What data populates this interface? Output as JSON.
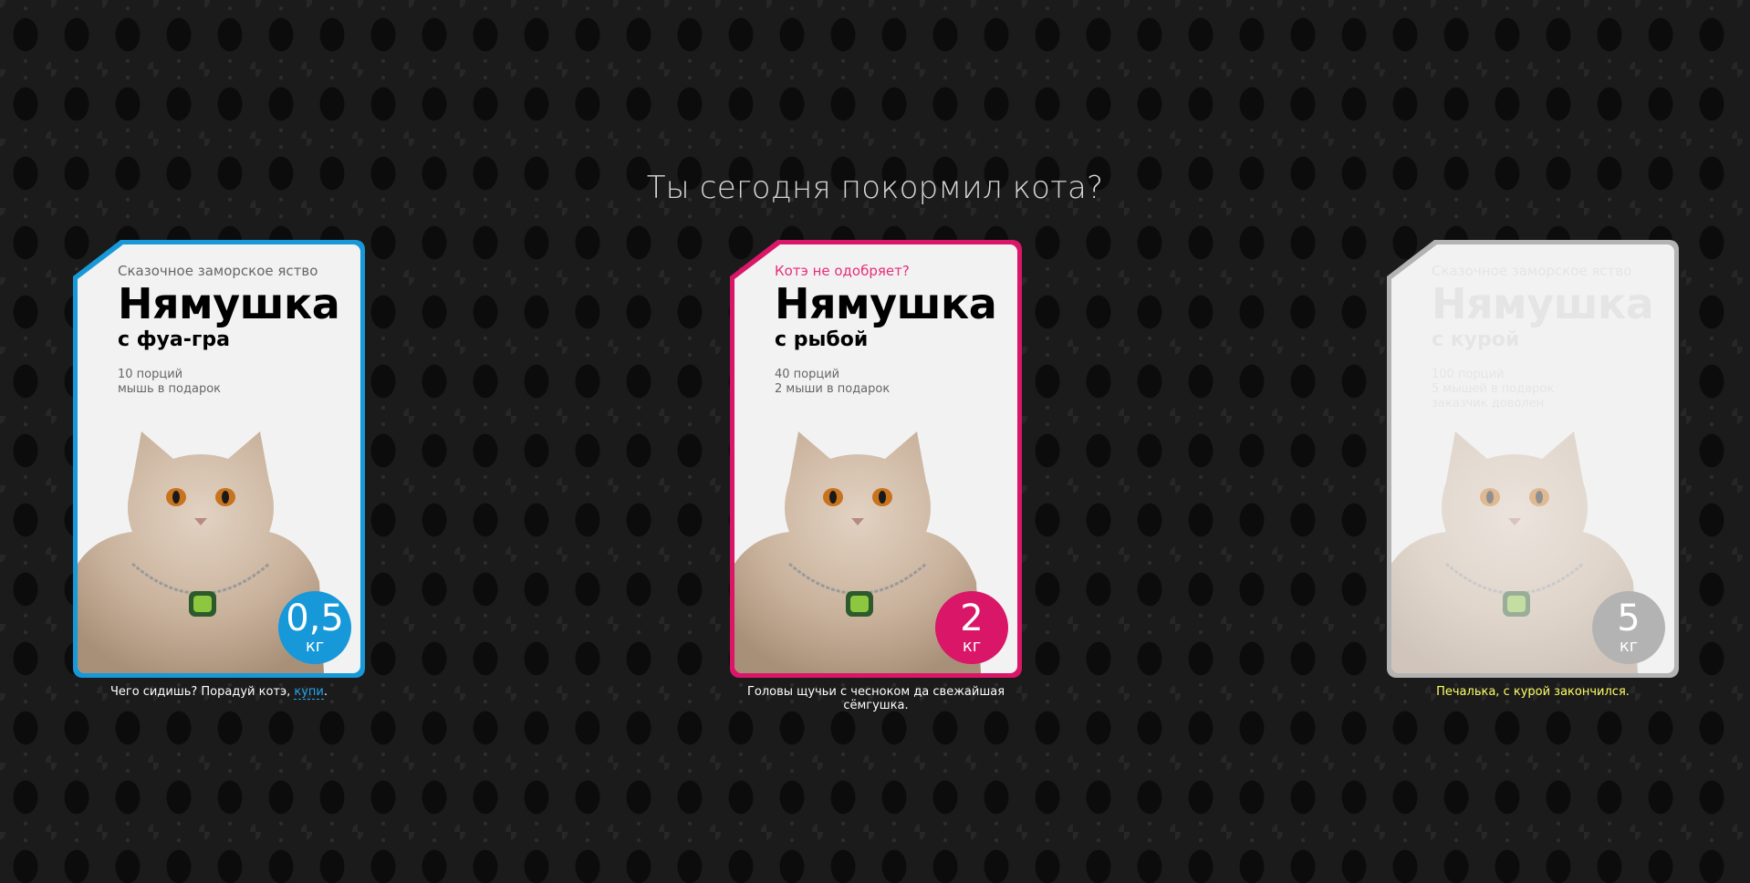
{
  "page_title": "Ты сегодня покормил кота?",
  "products": [
    {
      "tagline": "Сказочное заморское яство",
      "brand": "Нямушка",
      "flavor": "с фуа-гра",
      "details": [
        "10 порций",
        "мышь в подарок"
      ],
      "weight": "0,5",
      "unit": "кг",
      "caption_prefix": "Чего сидишь? Порадуй котэ, ",
      "caption_link": "купи",
      "caption_suffix": ".",
      "accent": "#1698d9",
      "state": "default"
    },
    {
      "tagline": "Котэ не одобряет?",
      "brand": "Нямушка",
      "flavor": "с рыбой",
      "details": [
        "40 порций",
        "2 мыши в подарок"
      ],
      "weight": "2",
      "unit": "кг",
      "caption": "Головы щучьи с чесноком да свежайшая сёмгушка.",
      "accent": "#d91667",
      "state": "selected"
    },
    {
      "tagline": "Сказочное заморское яство",
      "brand": "Нямушка",
      "flavor": "с курой",
      "details": [
        "100 порций",
        "5 мышей в подарок",
        "заказчик доволен"
      ],
      "weight": "5",
      "unit": "кг",
      "caption": "Печалька, с курой закончился.",
      "accent": "#b3b3b3",
      "state": "disabled"
    }
  ]
}
